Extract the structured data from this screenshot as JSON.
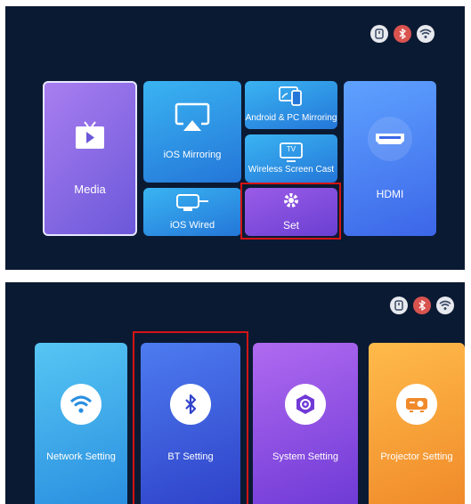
{
  "top": {
    "tiles": {
      "media": "Media",
      "ios_mirroring": "iOS Mirroring",
      "android_pc": "Android & PC Mirroring",
      "wireless_cast": "Wireless Screen Cast",
      "ios_wired": "iOS Wired",
      "set": "Set",
      "hdmi": "HDMI"
    },
    "tv_badge": "TV"
  },
  "bottom": {
    "tiles": {
      "network": "Network Setting",
      "bt": "BT Setting",
      "system": "System Setting",
      "projector": "Projector Setting"
    }
  },
  "colors": {
    "background": "#0b1a33",
    "highlight": "#d41414",
    "bt_status": "#d9534f"
  },
  "icons": [
    "usb-icon",
    "bluetooth-off-icon",
    "wifi-icon",
    "tv-play-icon",
    "airplay-icon",
    "phone-cast-icon",
    "tv-cast-icon",
    "cable-icon",
    "gear-icon",
    "hdmi-icon",
    "bluetooth-icon",
    "hexagon-settings-icon",
    "projector-icon"
  ]
}
